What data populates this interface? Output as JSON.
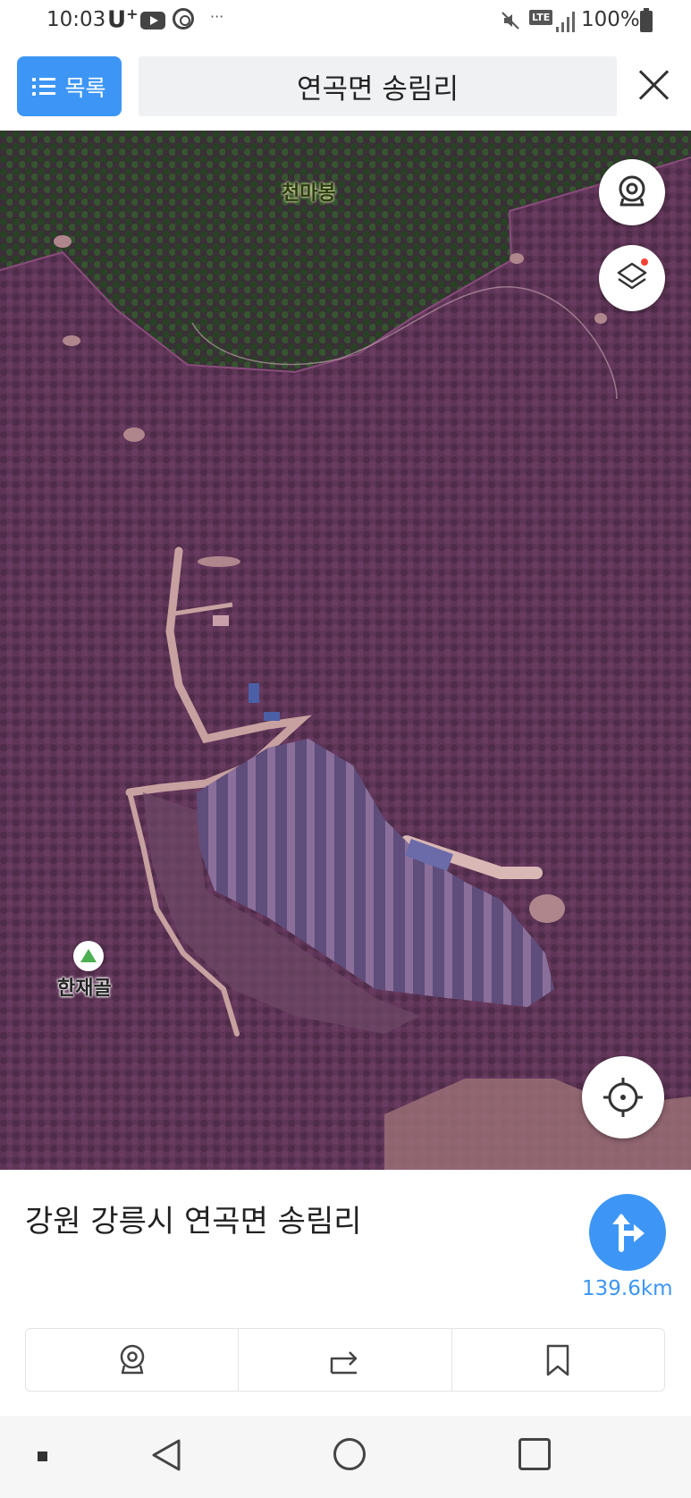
{
  "status_bar": {
    "time": "10:03",
    "carrier": "U",
    "carrier_sup": "+",
    "more": "···",
    "network": "LTE",
    "battery": "100%"
  },
  "header": {
    "list_button_label": "목록",
    "search_text": "연곡면 송림리"
  },
  "map": {
    "labels": {
      "peak": "천마봉",
      "valley": "한재골"
    },
    "colors": {
      "forest": "#2f4a2a",
      "district_overlay": "#7a3d6e"
    }
  },
  "info": {
    "address": "강원 강릉시 연곡면 송림리",
    "distance": "139.6km",
    "accent_color": "#3d96f5"
  },
  "actions": [
    {
      "name": "roadview",
      "icon": "roadview-icon"
    },
    {
      "name": "share",
      "icon": "share-icon"
    },
    {
      "name": "bookmark",
      "icon": "bookmark-icon"
    }
  ]
}
